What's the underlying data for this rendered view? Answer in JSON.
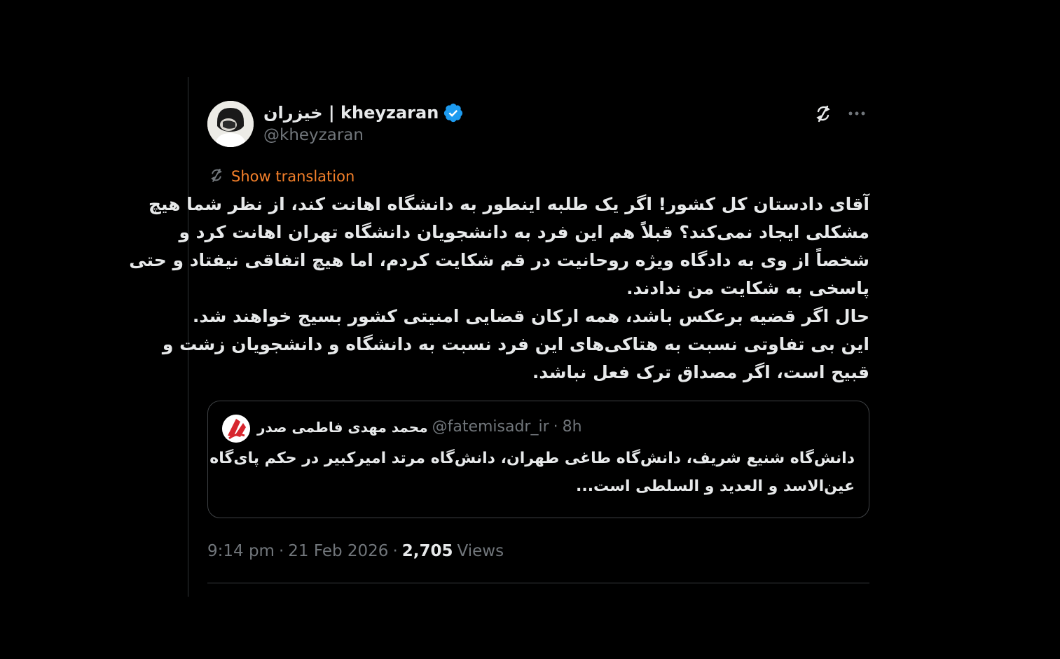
{
  "author": {
    "display_name": "خیزران | kheyzaran",
    "handle": "@kheyzaran",
    "verified": true,
    "verified_color": "#1d9bf0"
  },
  "header_icons": [
    "translate-icon",
    "more-icon"
  ],
  "translation": {
    "label": "Show translation",
    "color": "#f4802a"
  },
  "tweet": {
    "lines": [
      "آقای دادستان کل کشور! اگر یک طلبه اینطور به دانشگاه اهانت کند، از نظر شما هیچ",
      "مشکلی ایجاد نمی‌کند؟ قبلاً هم این فرد به دانشجویان دانشگاه تهران اهانت کرد و",
      "شخصاً از وی به دادگاه ویژه روحانیت در قم شکایت کردم، اما هیچ اتفاقی نیفتاد و حتی",
      "پاسخی به شکایت من ندادند.",
      "حال اگر قضیه برعکس باشد، همه ارکان قضایی امنیتی کشور بسیج خواهند شد.",
      "این بی تفاوتی نسبت به هتاکی‌های این فرد نسبت به دانشگاه و دانشجویان زشت و",
      "قبیح است، اگر مصداق ترک فعل نباشد."
    ]
  },
  "quoted_tweet": {
    "display_name": "محمد مهدی فاطمی صدر",
    "handle": "@fatemisadr_ir",
    "separator": "·",
    "time": "8h",
    "lines": [
      "دانش‌گاه شنیع شریف، دانش‌گاه طاغی طهران، دانش‌گاه مرتد امیرکبیر در حکم پای‌گاه",
      "عین‌الاسد و العدید و السلطی است..."
    ]
  },
  "meta": {
    "time": "9:14 pm",
    "sep1": "·",
    "date": "21 Feb 2026",
    "sep2": "·",
    "views_count": "2,705",
    "views_label": "Views"
  }
}
